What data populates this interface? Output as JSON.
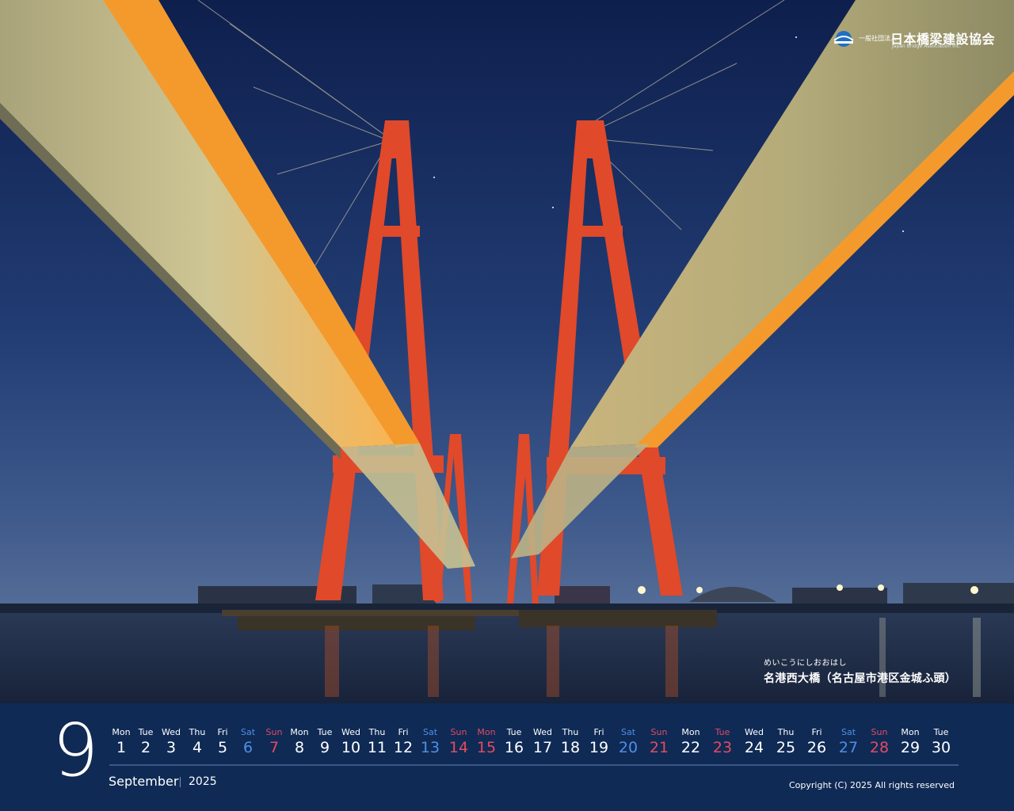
{
  "logo": {
    "small_text": "一般社団法人",
    "name": "日本橋梁建設協会",
    "english": "Japan Bridge Association Inc."
  },
  "caption": {
    "ruby": "めいこうにしおおはし",
    "title": "名港西大橋（名古屋市港区金城ふ頭）"
  },
  "calendar": {
    "month_number": "9",
    "month_name": "September",
    "year": "2025",
    "copyright": "Copyright (C) 2025 All rights reserved",
    "days": [
      {
        "dow": "Mon",
        "num": "1",
        "type": "weekday"
      },
      {
        "dow": "Tue",
        "num": "2",
        "type": "weekday"
      },
      {
        "dow": "Wed",
        "num": "3",
        "type": "weekday"
      },
      {
        "dow": "Thu",
        "num": "4",
        "type": "weekday"
      },
      {
        "dow": "Fri",
        "num": "5",
        "type": "weekday"
      },
      {
        "dow": "Sat",
        "num": "6",
        "type": "sat"
      },
      {
        "dow": "Sun",
        "num": "7",
        "type": "sun"
      },
      {
        "dow": "Mon",
        "num": "8",
        "type": "weekday"
      },
      {
        "dow": "Tue",
        "num": "9",
        "type": "weekday"
      },
      {
        "dow": "Wed",
        "num": "10",
        "type": "weekday"
      },
      {
        "dow": "Thu",
        "num": "11",
        "type": "weekday"
      },
      {
        "dow": "Fri",
        "num": "12",
        "type": "weekday"
      },
      {
        "dow": "Sat",
        "num": "13",
        "type": "sat"
      },
      {
        "dow": "Sun",
        "num": "14",
        "type": "sun"
      },
      {
        "dow": "Mon",
        "num": "15",
        "type": "sun"
      },
      {
        "dow": "Tue",
        "num": "16",
        "type": "weekday"
      },
      {
        "dow": "Wed",
        "num": "17",
        "type": "weekday"
      },
      {
        "dow": "Thu",
        "num": "18",
        "type": "weekday"
      },
      {
        "dow": "Fri",
        "num": "19",
        "type": "weekday"
      },
      {
        "dow": "Sat",
        "num": "20",
        "type": "sat"
      },
      {
        "dow": "Sun",
        "num": "21",
        "type": "sun"
      },
      {
        "dow": "Mon",
        "num": "22",
        "type": "weekday"
      },
      {
        "dow": "Tue",
        "num": "23",
        "type": "sun"
      },
      {
        "dow": "Wed",
        "num": "24",
        "type": "weekday"
      },
      {
        "dow": "Thu",
        "num": "25",
        "type": "weekday"
      },
      {
        "dow": "Fri",
        "num": "26",
        "type": "weekday"
      },
      {
        "dow": "Sat",
        "num": "27",
        "type": "sat"
      },
      {
        "dow": "Sun",
        "num": "28",
        "type": "sun"
      },
      {
        "dow": "Mon",
        "num": "29",
        "type": "weekday"
      },
      {
        "dow": "Tue",
        "num": "30",
        "type": "weekday"
      }
    ]
  },
  "colors": {
    "background": "#0f2a55",
    "saturday": "#4e8fe8",
    "sunday_holiday": "#e24b61",
    "tower": "#e0492a",
    "deck_light": "#f59a2a"
  }
}
